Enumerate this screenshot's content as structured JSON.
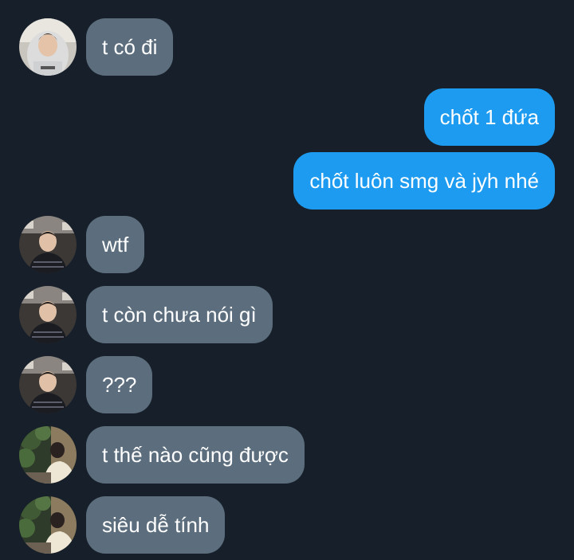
{
  "messages": [
    {
      "direction": "in",
      "avatar": "avatar-hoodie",
      "text": "t có đi"
    },
    {
      "direction": "out",
      "text": "chốt 1 đứa"
    },
    {
      "direction": "out",
      "text": "chốt luôn smg và jyh nhé"
    },
    {
      "direction": "in",
      "avatar": "avatar-dark-sweater",
      "text": "wtf"
    },
    {
      "direction": "in",
      "avatar": "avatar-dark-sweater",
      "text": "t còn chưa nói gì"
    },
    {
      "direction": "in",
      "avatar": "avatar-dark-sweater",
      "text": "???"
    },
    {
      "direction": "in",
      "avatar": "avatar-plants",
      "text": "t thế nào cũng được"
    },
    {
      "direction": "in",
      "avatar": "avatar-plants",
      "text": "siêu dễ tính"
    }
  ],
  "colors": {
    "background": "#17202a",
    "incoming_bubble": "#5c6e7e",
    "outgoing_bubble": "#1d9bf0",
    "text": "#ffffff"
  }
}
